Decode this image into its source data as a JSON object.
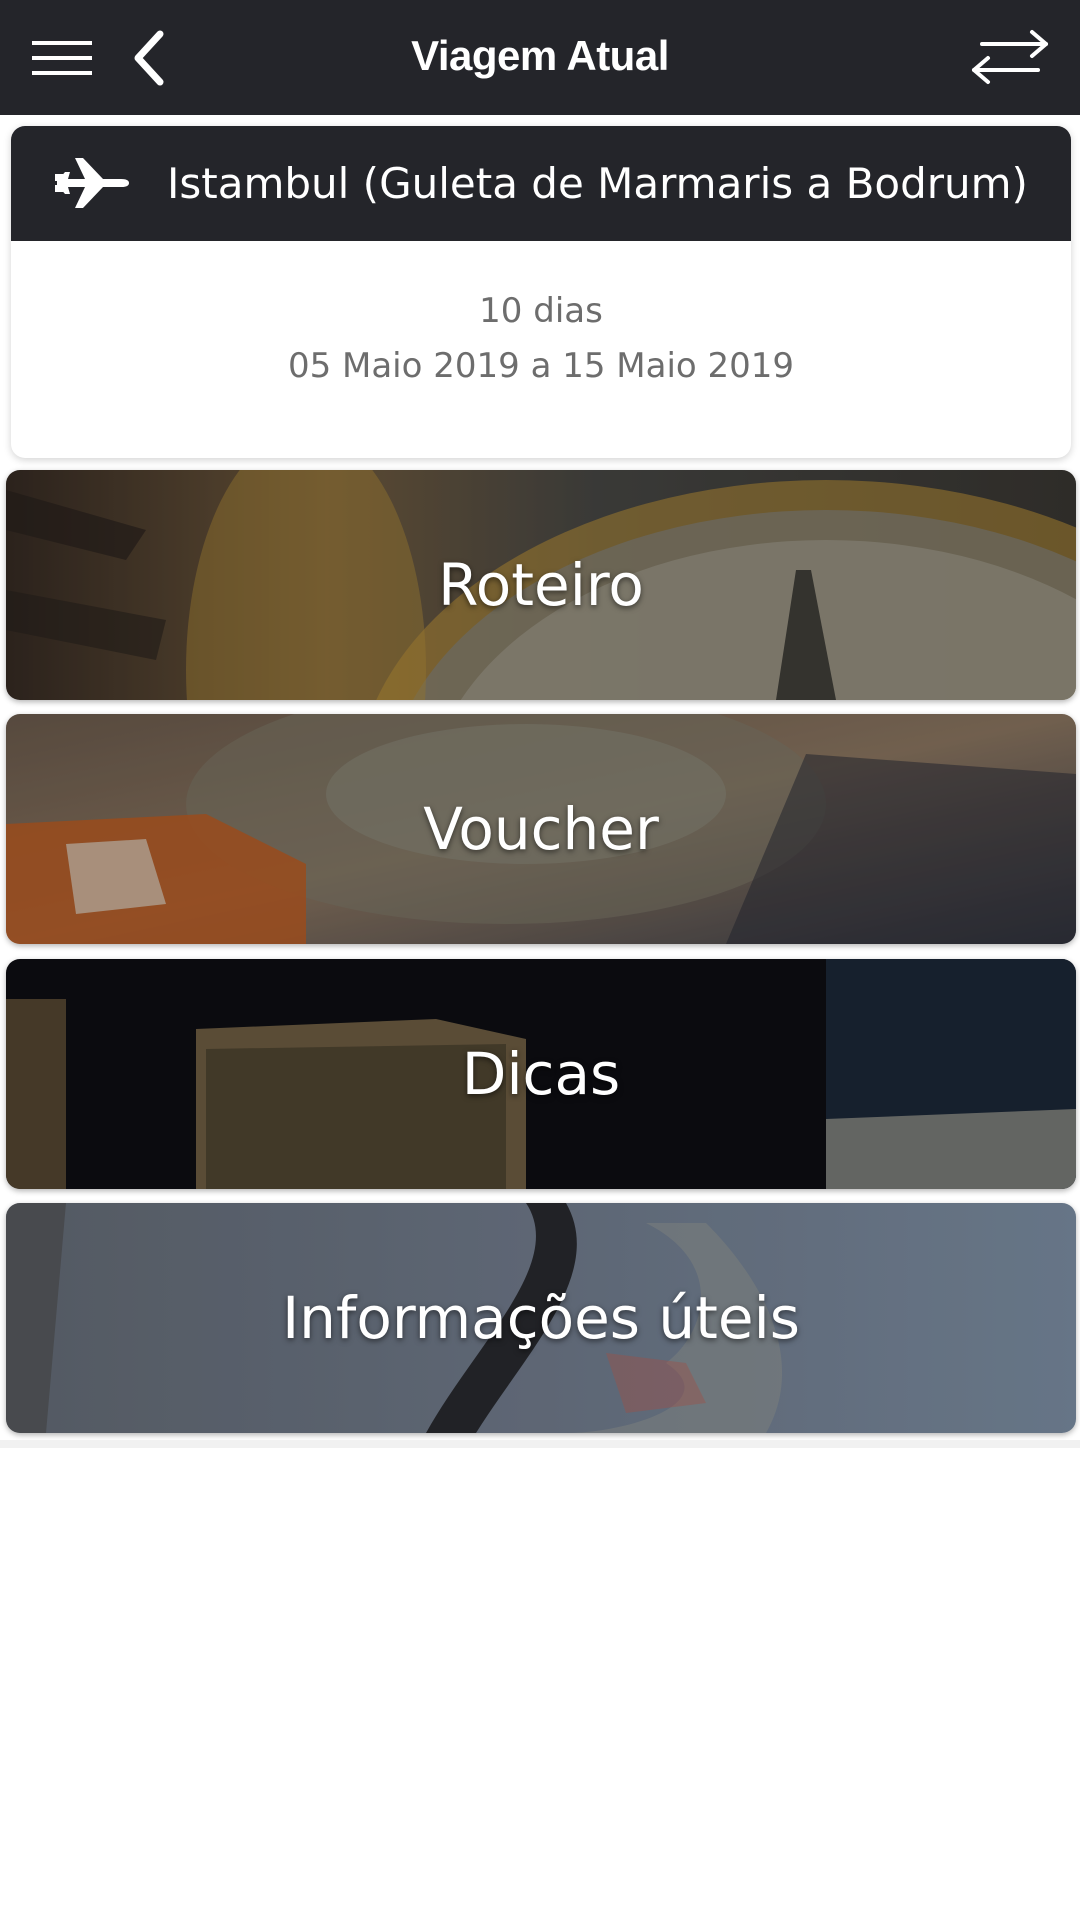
{
  "header": {
    "title": "Viagem Atual",
    "icons": {
      "menu": "hamburger-menu-icon",
      "back": "chevron-left-icon",
      "swap": "swap-arrows-icon"
    }
  },
  "trip": {
    "icon": "airplane-icon",
    "name": "Istambul (Guleta de Marmaris a Bodrum) ...",
    "duration": "10 dias",
    "dates": "05 Maio 2019 a 15 Maio 2019"
  },
  "tiles": [
    {
      "label": "Roteiro"
    },
    {
      "label": "Voucher"
    },
    {
      "label": "Dicas"
    },
    {
      "label": "Informações úteis"
    }
  ],
  "colors": {
    "header_bg": "#24252a",
    "text_light": "#ffffff",
    "text_muted": "#6d6d6d"
  }
}
